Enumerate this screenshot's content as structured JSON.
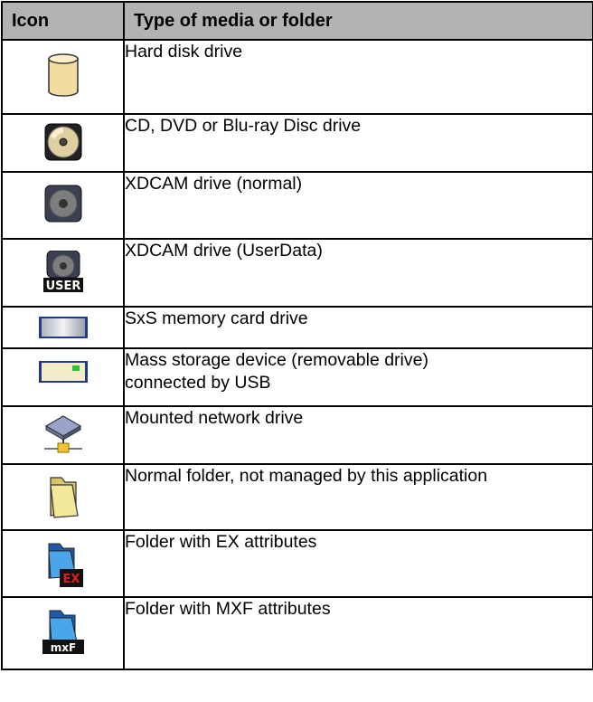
{
  "table": {
    "headers": {
      "icon": "Icon",
      "type": "Type of media or folder"
    },
    "rows": [
      {
        "icon": "hard-disk-drive-icon",
        "label": "Hard disk drive"
      },
      {
        "icon": "optical-disc-drive-icon",
        "label": "CD, DVD or Blu-ray Disc drive"
      },
      {
        "icon": "xdcam-drive-icon",
        "label": "XDCAM drive (normal)"
      },
      {
        "icon": "xdcam-userdata-drive-icon",
        "label": "XDCAM drive (UserData)",
        "icon_text": "USER"
      },
      {
        "icon": "sxs-memory-card-icon",
        "label": "SxS memory card drive"
      },
      {
        "icon": "usb-mass-storage-icon",
        "label_line1": "Mass storage device (removable drive)",
        "label_line2": "connected by USB"
      },
      {
        "icon": "network-drive-icon",
        "label": "Mounted network drive"
      },
      {
        "icon": "folder-icon",
        "label": "Normal folder, not managed by this application"
      },
      {
        "icon": "ex-folder-icon",
        "label": "Folder with EX attributes",
        "icon_text": "EX"
      },
      {
        "icon": "mxf-folder-icon",
        "label": "Folder with MXF attributes",
        "icon_text": "mxF"
      }
    ]
  }
}
